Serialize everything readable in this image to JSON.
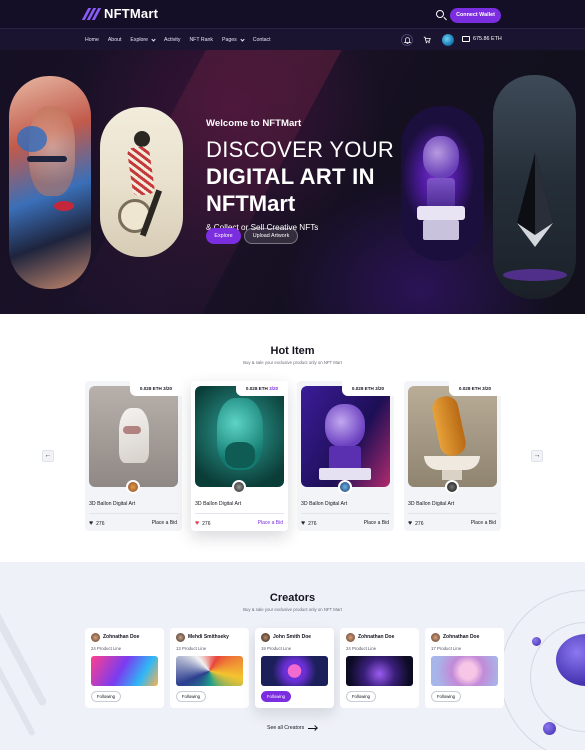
{
  "header": {
    "logo_text": "NFTMart",
    "connect_wallet": "Connect Wallet"
  },
  "nav": {
    "links": [
      {
        "label": "Home"
      },
      {
        "label": "About"
      },
      {
        "label": "Explore",
        "dropdown": true
      },
      {
        "label": "Activity"
      },
      {
        "label": "NFT Rank"
      },
      {
        "label": "Pages",
        "dropdown": true
      },
      {
        "label": "Contact"
      }
    ],
    "balance": "675.86 ETH"
  },
  "hero": {
    "welcome": "Welcome to NFTMart",
    "line1": "DISCOVER YOUR",
    "line2": "DIGITAL ART IN",
    "line3": "NFTMart",
    "subtitle": "& Collect or Sell Creative NFTs",
    "explore_button": "Explore",
    "upload_button": "Upload Artwork"
  },
  "hot": {
    "title": "Hot Item",
    "subtitle": "Buy & sale your exclusive product only on NFT Mart",
    "items": [
      {
        "price": "0.028 ETH",
        "count": "3/20",
        "name": "3D Ballon Digital Art",
        "likes": "276",
        "bid": "Place a Bid",
        "active": false
      },
      {
        "price": "0.028 ETH",
        "count": "3/20",
        "name": "3D Ballon Digital Art",
        "likes": "276",
        "bid": "Place a Bid",
        "active": true
      },
      {
        "price": "0.028 ETH",
        "count": "3/20",
        "name": "3D Ballon Digital Art",
        "likes": "276",
        "bid": "Place a Bid",
        "active": false
      },
      {
        "price": "0.028 ETH",
        "count": "3/20",
        "name": "3D Ballon Digital Art",
        "likes": "276",
        "bid": "Place a Bid",
        "active": false
      }
    ]
  },
  "creators": {
    "title": "Creators",
    "subtitle": "Buy & sale your exclusive product only on NFT Mart",
    "items": [
      {
        "name": "Zohnathan Doe",
        "lines": "24 Product Line",
        "follow": "Following"
      },
      {
        "name": "Mehdi Smithseky",
        "lines": "13 Product Line",
        "follow": "Following"
      },
      {
        "name": "John Smith Doe",
        "lines": "19 Product Line",
        "follow": "Following"
      },
      {
        "name": "Zohnathan Doe",
        "lines": "24 Product Line",
        "follow": "Following"
      },
      {
        "name": "Zohnathan Doe",
        "lines": "17 Product Line",
        "follow": "Following"
      }
    ],
    "see_all": "See all Creators"
  },
  "colors": {
    "accent": "#7b2de0",
    "dark_bg": "#140f26",
    "like_active": "#e23b4c"
  }
}
